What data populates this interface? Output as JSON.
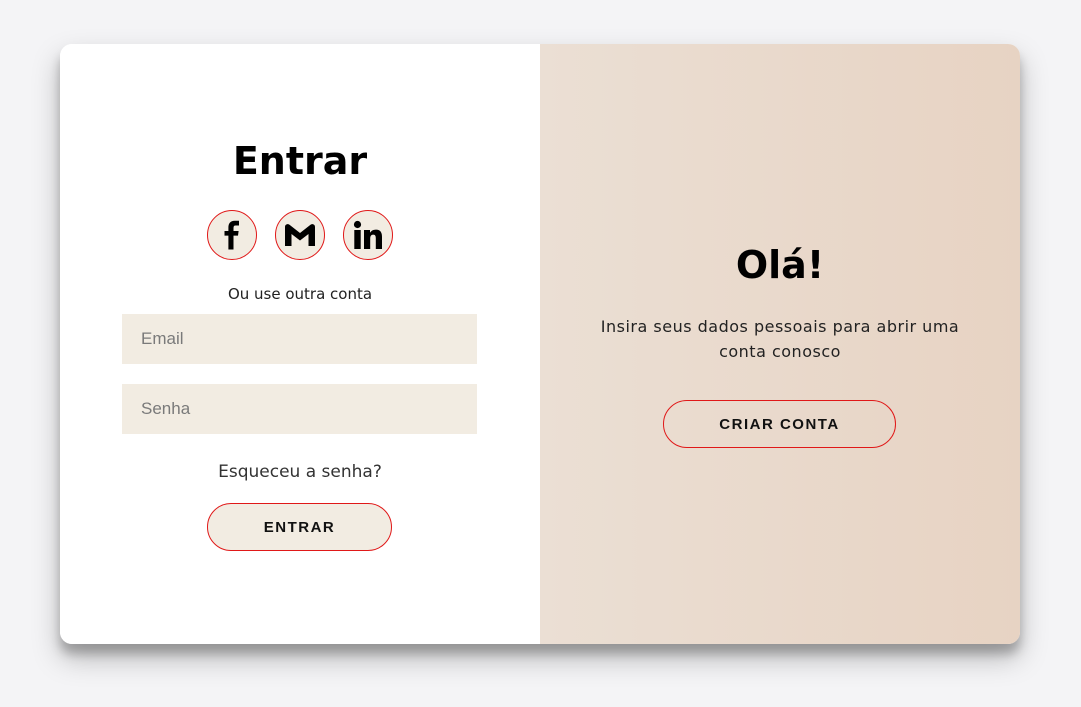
{
  "signin": {
    "title": "Entrar",
    "socials": [
      {
        "name": "facebook",
        "icon": "facebook-icon"
      },
      {
        "name": "gmail",
        "icon": "gmail-icon"
      },
      {
        "name": "linkedin",
        "icon": "linkedin-icon"
      }
    ],
    "alt_text": "Ou use outra conta",
    "email_placeholder": "Email",
    "password_placeholder": "Senha",
    "forgot_label": "Esqueceu a senha?",
    "submit_label": "ENTRAR"
  },
  "overlay": {
    "title": "Olá!",
    "description": "Insira seus dados pessoais para abrir uma conta conosco",
    "button_label": "CRIAR CONTA"
  },
  "colors": {
    "accent_border": "#e01818",
    "field_bg": "#f2ece2",
    "panel_gradient_start": "#ebdfd4",
    "panel_gradient_end": "#e7d3c3",
    "page_bg": "#f4f4f6"
  }
}
